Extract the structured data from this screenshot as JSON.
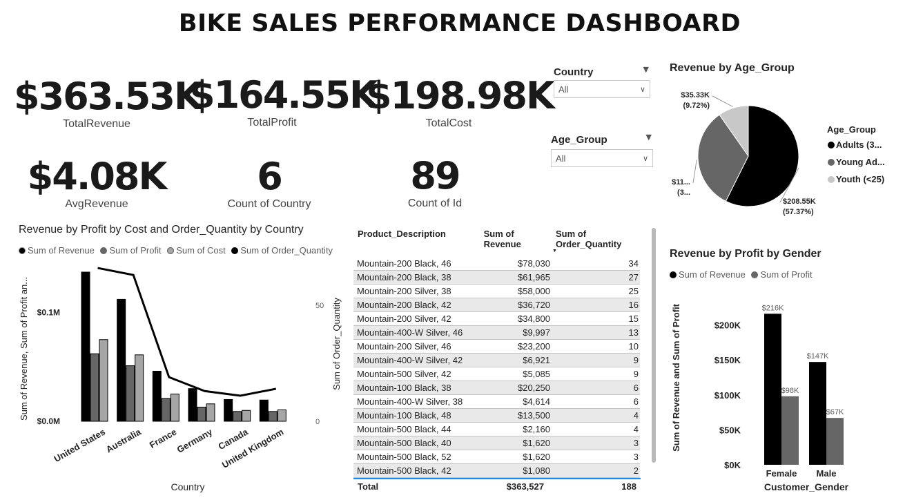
{
  "dashboard_title": "BIKE SALES PERFORMANCE DASHBOARD",
  "kpis": [
    {
      "value": "$363.53K",
      "label": "TotalRevenue"
    },
    {
      "value": "$164.55K",
      "label": "TotalProfit"
    },
    {
      "value": "$198.98K",
      "label": "TotalCost"
    },
    {
      "value": "$4.08K",
      "label": "AvgRevenue"
    },
    {
      "value": "6",
      "label": "Count of Country"
    },
    {
      "value": "89",
      "label": "Count of Id"
    }
  ],
  "slicers": [
    {
      "title": "Country",
      "value": "All"
    },
    {
      "title": "Age_Group",
      "value": "All"
    }
  ],
  "colors": {
    "black": "#000000",
    "dark_gray": "#666666",
    "light_gray": "#a6a6a6",
    "pie_light": "#c8c8c8",
    "table_accent": "#118dff"
  },
  "chart_data": [
    {
      "type": "bar",
      "title": "Revenue by Profit by Cost and Order_Quantity by Country",
      "legend": [
        "Sum of Revenue",
        "Sum of Profit",
        "Sum of Cost",
        "Sum of Order_Quantity"
      ],
      "legend_position": "top-left",
      "categories": [
        "United States",
        "Australia",
        "France",
        "Germany",
        "Canada",
        "United Kingdom"
      ],
      "series": [
        {
          "name": "Sum of Revenue",
          "kind": "bar",
          "color": "#000000",
          "values": [
            137000,
            112000,
            46000,
            30000,
            20000,
            19500
          ]
        },
        {
          "name": "Sum of Profit",
          "kind": "bar",
          "color": "#666666",
          "values": [
            62000,
            51000,
            21000,
            13000,
            9000,
            9000
          ]
        },
        {
          "name": "Sum of Cost",
          "kind": "bar",
          "color": "#a6a6a6",
          "values": [
            75000,
            61000,
            25000,
            16000,
            10000,
            10500
          ]
        },
        {
          "name": "Sum of Order_Quantity",
          "kind": "line",
          "color": "#000000",
          "axis": "right",
          "values": [
            66,
            63,
            19,
            13,
            11,
            14
          ]
        }
      ],
      "xlabel": "Country",
      "ylabel": "Sum of Revenue, Sum of Profit an...",
      "y2label": "Sum of Order_Quantity",
      "ylim": [
        0,
        137000
      ],
      "y2lim": [
        0,
        69
      ],
      "yticks": [
        {
          "value": 0,
          "label": "$0.0M"
        },
        {
          "value": 100000,
          "label": "$0.1M"
        }
      ],
      "y2ticks": [
        {
          "value": 0,
          "label": "0"
        },
        {
          "value": 50,
          "label": "50"
        }
      ]
    },
    {
      "type": "pie",
      "title": "Revenue by Age_Group",
      "legend_title": "Age_Group",
      "legend": [
        "Adults (3...",
        "Young Ad...",
        "Youth (<25)"
      ],
      "legend_position": "right",
      "slices": [
        {
          "name": "Adults (3...",
          "value": 208550,
          "percent": 57.37,
          "color": "#000000",
          "label_value": "$208.55K",
          "label_pct": "(57.37%)"
        },
        {
          "name": "Young Ad...",
          "value": 119650,
          "percent": 32.91,
          "color": "#666666",
          "label_value": "$11...",
          "label_pct": "(3..."
        },
        {
          "name": "Youth (<25)",
          "value": 35330,
          "percent": 9.72,
          "color": "#c8c8c8",
          "label_value": "$35.33K",
          "label_pct": "(9.72%)"
        }
      ]
    },
    {
      "type": "bar",
      "title": "Revenue by Profit by Gender",
      "legend": [
        "Sum of Revenue",
        "Sum of Profit"
      ],
      "legend_position": "top-left",
      "categories": [
        "Female",
        "Male"
      ],
      "series": [
        {
          "name": "Sum of Revenue",
          "color": "#000000",
          "values": [
            216000,
            147000
          ],
          "labels": [
            "$216K",
            "$147K"
          ]
        },
        {
          "name": "Sum of Profit",
          "color": "#666666",
          "values": [
            98000,
            67000
          ],
          "labels": [
            "$98K",
            "$67K"
          ]
        }
      ],
      "xlabel": "Customer_Gender",
      "ylabel": "Sum of Revenue and Sum of Profit",
      "ylim": [
        0,
        240000
      ],
      "yticks": [
        {
          "value": 0,
          "label": "$0K"
        },
        {
          "value": 50000,
          "label": "$50K"
        },
        {
          "value": 100000,
          "label": "$100K"
        },
        {
          "value": 150000,
          "label": "$150K"
        },
        {
          "value": 200000,
          "label": "$200K"
        }
      ]
    },
    {
      "type": "table",
      "columns": [
        "Product_Description",
        "Sum of Revenue",
        "Sum of Order_Quantity"
      ],
      "rows": [
        [
          "Mountain-200 Black, 46",
          "$78,030",
          "34"
        ],
        [
          "Mountain-200 Black, 38",
          "$61,965",
          "27"
        ],
        [
          "Mountain-200 Silver, 38",
          "$58,000",
          "25"
        ],
        [
          "Mountain-200 Black, 42",
          "$36,720",
          "16"
        ],
        [
          "Mountain-200 Silver, 42",
          "$34,800",
          "15"
        ],
        [
          "Mountain-400-W Silver, 46",
          "$9,997",
          "13"
        ],
        [
          "Mountain-200 Silver, 46",
          "$23,200",
          "10"
        ],
        [
          "Mountain-400-W Silver, 42",
          "$6,921",
          "9"
        ],
        [
          "Mountain-500 Silver, 42",
          "$5,085",
          "9"
        ],
        [
          "Mountain-100 Black, 38",
          "$20,250",
          "6"
        ],
        [
          "Mountain-400-W Silver, 38",
          "$4,614",
          "6"
        ],
        [
          "Mountain-100 Black, 48",
          "$13,500",
          "4"
        ],
        [
          "Mountain-500 Black, 44",
          "$2,160",
          "4"
        ],
        [
          "Mountain-500 Black, 40",
          "$1,620",
          "3"
        ],
        [
          "Mountain-500 Black, 52",
          "$1,620",
          "3"
        ],
        [
          "Mountain-500 Black, 42",
          "$1,080",
          "2"
        ]
      ],
      "total": [
        "Total",
        "$363,527",
        "188"
      ],
      "sort_column": "Sum of Order_Quantity",
      "sort_indicator": "▼"
    }
  ]
}
